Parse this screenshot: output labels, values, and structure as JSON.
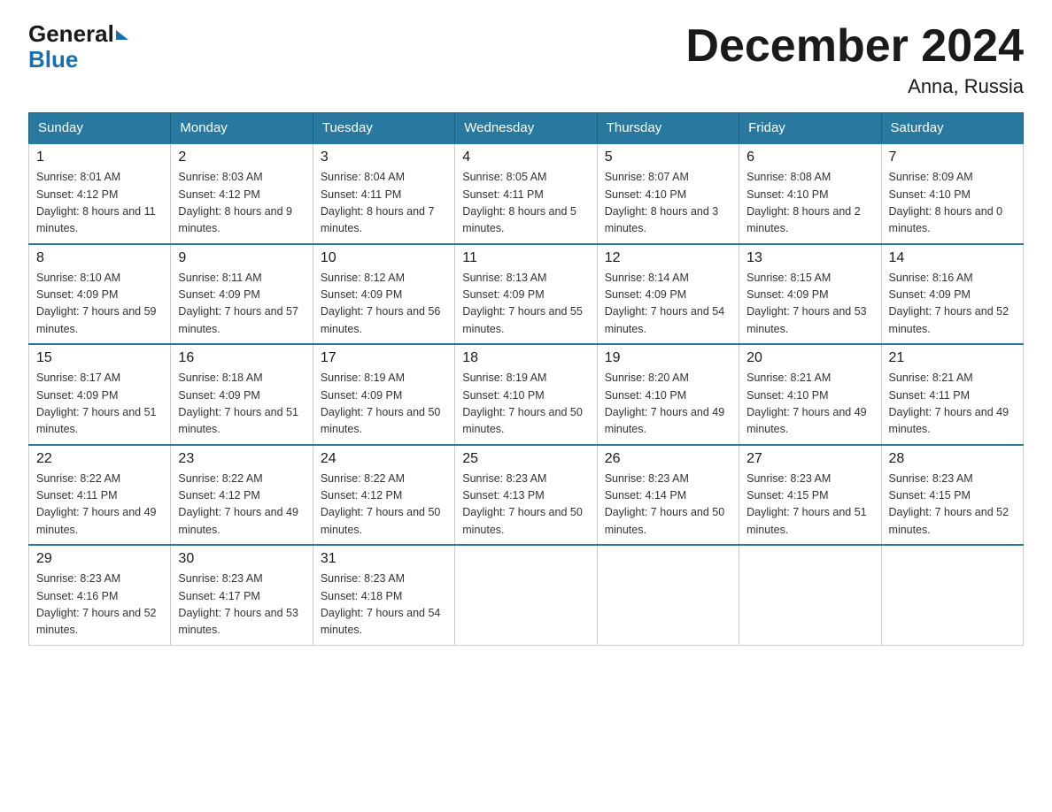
{
  "logo": {
    "general": "General",
    "blue": "Blue"
  },
  "title": {
    "month": "December 2024",
    "location": "Anna, Russia"
  },
  "weekdays": [
    "Sunday",
    "Monday",
    "Tuesday",
    "Wednesday",
    "Thursday",
    "Friday",
    "Saturday"
  ],
  "weeks": [
    [
      {
        "day": "1",
        "sunrise": "8:01 AM",
        "sunset": "4:12 PM",
        "daylight": "8 hours and 11 minutes."
      },
      {
        "day": "2",
        "sunrise": "8:03 AM",
        "sunset": "4:12 PM",
        "daylight": "8 hours and 9 minutes."
      },
      {
        "day": "3",
        "sunrise": "8:04 AM",
        "sunset": "4:11 PM",
        "daylight": "8 hours and 7 minutes."
      },
      {
        "day": "4",
        "sunrise": "8:05 AM",
        "sunset": "4:11 PM",
        "daylight": "8 hours and 5 minutes."
      },
      {
        "day": "5",
        "sunrise": "8:07 AM",
        "sunset": "4:10 PM",
        "daylight": "8 hours and 3 minutes."
      },
      {
        "day": "6",
        "sunrise": "8:08 AM",
        "sunset": "4:10 PM",
        "daylight": "8 hours and 2 minutes."
      },
      {
        "day": "7",
        "sunrise": "8:09 AM",
        "sunset": "4:10 PM",
        "daylight": "8 hours and 0 minutes."
      }
    ],
    [
      {
        "day": "8",
        "sunrise": "8:10 AM",
        "sunset": "4:09 PM",
        "daylight": "7 hours and 59 minutes."
      },
      {
        "day": "9",
        "sunrise": "8:11 AM",
        "sunset": "4:09 PM",
        "daylight": "7 hours and 57 minutes."
      },
      {
        "day": "10",
        "sunrise": "8:12 AM",
        "sunset": "4:09 PM",
        "daylight": "7 hours and 56 minutes."
      },
      {
        "day": "11",
        "sunrise": "8:13 AM",
        "sunset": "4:09 PM",
        "daylight": "7 hours and 55 minutes."
      },
      {
        "day": "12",
        "sunrise": "8:14 AM",
        "sunset": "4:09 PM",
        "daylight": "7 hours and 54 minutes."
      },
      {
        "day": "13",
        "sunrise": "8:15 AM",
        "sunset": "4:09 PM",
        "daylight": "7 hours and 53 minutes."
      },
      {
        "day": "14",
        "sunrise": "8:16 AM",
        "sunset": "4:09 PM",
        "daylight": "7 hours and 52 minutes."
      }
    ],
    [
      {
        "day": "15",
        "sunrise": "8:17 AM",
        "sunset": "4:09 PM",
        "daylight": "7 hours and 51 minutes."
      },
      {
        "day": "16",
        "sunrise": "8:18 AM",
        "sunset": "4:09 PM",
        "daylight": "7 hours and 51 minutes."
      },
      {
        "day": "17",
        "sunrise": "8:19 AM",
        "sunset": "4:09 PM",
        "daylight": "7 hours and 50 minutes."
      },
      {
        "day": "18",
        "sunrise": "8:19 AM",
        "sunset": "4:10 PM",
        "daylight": "7 hours and 50 minutes."
      },
      {
        "day": "19",
        "sunrise": "8:20 AM",
        "sunset": "4:10 PM",
        "daylight": "7 hours and 49 minutes."
      },
      {
        "day": "20",
        "sunrise": "8:21 AM",
        "sunset": "4:10 PM",
        "daylight": "7 hours and 49 minutes."
      },
      {
        "day": "21",
        "sunrise": "8:21 AM",
        "sunset": "4:11 PM",
        "daylight": "7 hours and 49 minutes."
      }
    ],
    [
      {
        "day": "22",
        "sunrise": "8:22 AM",
        "sunset": "4:11 PM",
        "daylight": "7 hours and 49 minutes."
      },
      {
        "day": "23",
        "sunrise": "8:22 AM",
        "sunset": "4:12 PM",
        "daylight": "7 hours and 49 minutes."
      },
      {
        "day": "24",
        "sunrise": "8:22 AM",
        "sunset": "4:12 PM",
        "daylight": "7 hours and 50 minutes."
      },
      {
        "day": "25",
        "sunrise": "8:23 AM",
        "sunset": "4:13 PM",
        "daylight": "7 hours and 50 minutes."
      },
      {
        "day": "26",
        "sunrise": "8:23 AM",
        "sunset": "4:14 PM",
        "daylight": "7 hours and 50 minutes."
      },
      {
        "day": "27",
        "sunrise": "8:23 AM",
        "sunset": "4:15 PM",
        "daylight": "7 hours and 51 minutes."
      },
      {
        "day": "28",
        "sunrise": "8:23 AM",
        "sunset": "4:15 PM",
        "daylight": "7 hours and 52 minutes."
      }
    ],
    [
      {
        "day": "29",
        "sunrise": "8:23 AM",
        "sunset": "4:16 PM",
        "daylight": "7 hours and 52 minutes."
      },
      {
        "day": "30",
        "sunrise": "8:23 AM",
        "sunset": "4:17 PM",
        "daylight": "7 hours and 53 minutes."
      },
      {
        "day": "31",
        "sunrise": "8:23 AM",
        "sunset": "4:18 PM",
        "daylight": "7 hours and 54 minutes."
      },
      null,
      null,
      null,
      null
    ]
  ]
}
